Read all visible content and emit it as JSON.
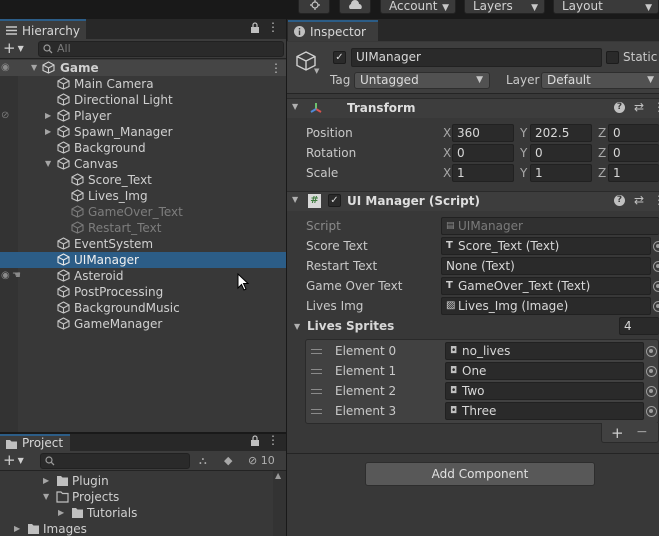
{
  "toolbar": {
    "account_label": "Account",
    "layers_label": "Layers",
    "layout_label": "Layout"
  },
  "hierarchy": {
    "tab_label": "Hierarchy",
    "search_placeholder": "All",
    "items": [
      {
        "label": "Game"
      },
      {
        "label": "Main Camera"
      },
      {
        "label": "Directional Light"
      },
      {
        "label": "Player"
      },
      {
        "label": "Spawn_Manager"
      },
      {
        "label": "Background"
      },
      {
        "label": "Canvas"
      },
      {
        "label": "Score_Text"
      },
      {
        "label": "Lives_Img"
      },
      {
        "label": "GameOver_Text"
      },
      {
        "label": "Restart_Text"
      },
      {
        "label": "EventSystem"
      },
      {
        "label": "UIManager"
      },
      {
        "label": "Asteroid"
      },
      {
        "label": "PostProcessing"
      },
      {
        "label": "BackgroundMusic"
      },
      {
        "label": "GameManager"
      }
    ]
  },
  "project": {
    "tab_label": "Project",
    "hidden_count": "10",
    "items": [
      {
        "label": "Plugin"
      },
      {
        "label": "Projects"
      },
      {
        "label": "Tutorials"
      },
      {
        "label": "Images"
      }
    ]
  },
  "inspector": {
    "tab_label": "Inspector",
    "object_name": "UIManager",
    "static_label": "Static",
    "tag_label": "Tag",
    "tag_value": "Untagged",
    "layer_label": "Layer",
    "layer_value": "Default",
    "transform": {
      "title": "Transform",
      "position_label": "Position",
      "rotation_label": "Rotation",
      "scale_label": "Scale",
      "x": "X",
      "y": "Y",
      "z": "Z",
      "position": [
        "360",
        "202.5",
        "0"
      ],
      "rotation": [
        "0",
        "0",
        "0"
      ],
      "scale": [
        "1",
        "1",
        "1"
      ]
    },
    "ui_manager": {
      "title": "UI Manager (Script)",
      "script_label": "Script",
      "script_value": "UIManager",
      "score_text_label": "Score Text",
      "score_text_value": "Score_Text (Text)",
      "restart_text_label": "Restart Text",
      "restart_text_value": "None (Text)",
      "game_over_text_label": "Game Over Text",
      "game_over_text_value": "GameOver_Text (Text)",
      "lives_img_label": "Lives Img",
      "lives_img_value": "Lives_Img (Image)",
      "lives_sprites_label": "Lives Sprites",
      "lives_sprites_count": "4",
      "elements": [
        {
          "label": "Element 0",
          "value": "no_lives"
        },
        {
          "label": "Element 1",
          "value": "One"
        },
        {
          "label": "Element 2",
          "value": "Two"
        },
        {
          "label": "Element 3",
          "value": "Three"
        }
      ],
      "add_symbol": "+",
      "remove_symbol": "−"
    },
    "add_component_label": "Add Component"
  },
  "colors": {
    "selection": "#2c5d87",
    "panel": "#383838",
    "background": "#191919"
  }
}
